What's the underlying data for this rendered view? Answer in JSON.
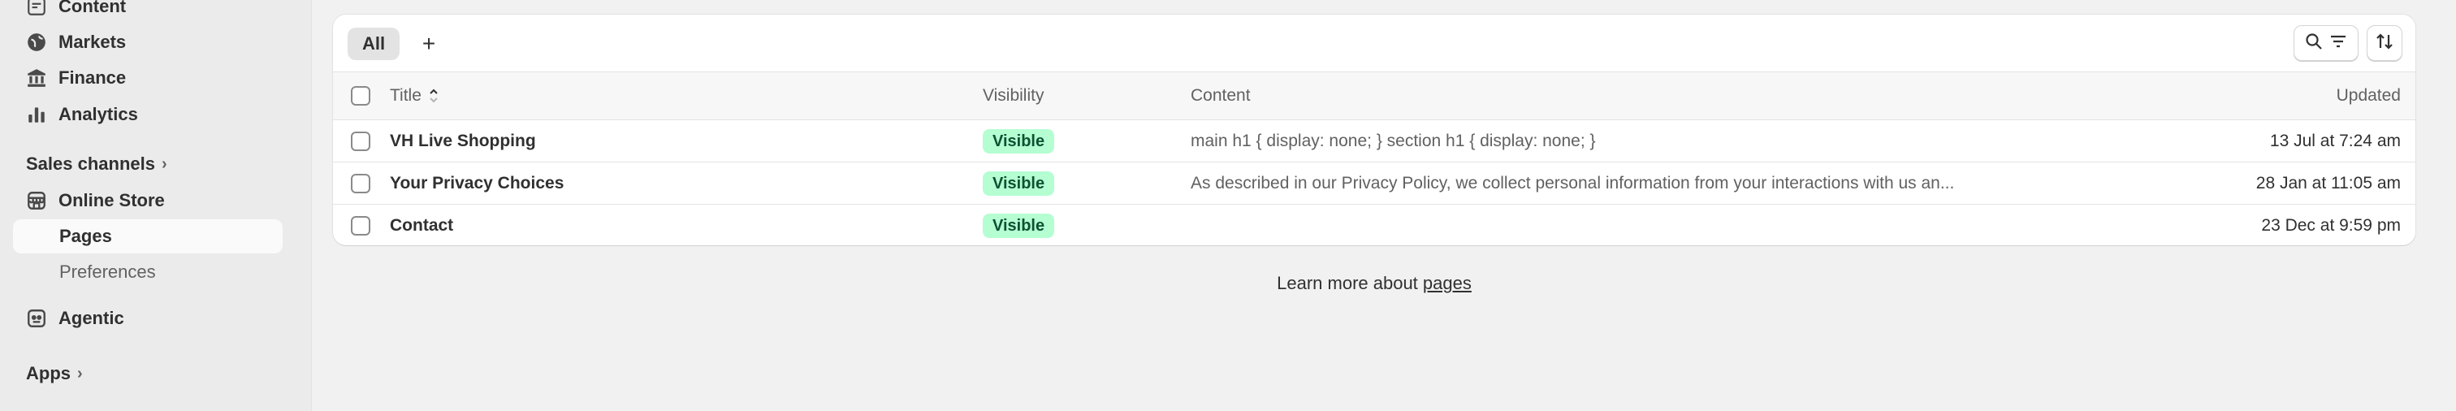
{
  "sidebar": {
    "items": [
      {
        "label": "Content",
        "icon": "content-icon"
      },
      {
        "label": "Markets",
        "icon": "globe-icon"
      },
      {
        "label": "Finance",
        "icon": "bank-icon"
      },
      {
        "label": "Analytics",
        "icon": "bar-chart-icon"
      }
    ],
    "sales_channels_label": "Sales channels",
    "online_store_label": "Online Store",
    "pages_label": "Pages",
    "preferences_label": "Preferences",
    "agentic_label": "Agentic",
    "apps_label": "Apps"
  },
  "toolbar": {
    "tab_all": "All",
    "add_tab": "+"
  },
  "table": {
    "columns": {
      "title": "Title",
      "visibility": "Visibility",
      "content": "Content",
      "updated": "Updated"
    },
    "rows": [
      {
        "title": "VH Live Shopping",
        "visibility": "Visible",
        "content": "main h1 { display: none; } section h1 { display: none; }",
        "updated": "13 Jul at 7:24 am"
      },
      {
        "title": "Your Privacy Choices",
        "visibility": "Visible",
        "content": "As described in our Privacy Policy, we collect personal information from your interactions with us an...",
        "updated": "28 Jan at 11:05 am"
      },
      {
        "title": "Contact",
        "visibility": "Visible",
        "content": "",
        "updated": "23 Dec at 9:59 pm"
      }
    ]
  },
  "footer": {
    "learn_more_prefix": "Learn more about ",
    "learn_more_link": "pages"
  },
  "colors": {
    "badge_bg": "#b4fed2",
    "badge_text": "#0c5132",
    "page_bg": "#f1f1f1",
    "sidebar_bg": "#ebebeb"
  }
}
